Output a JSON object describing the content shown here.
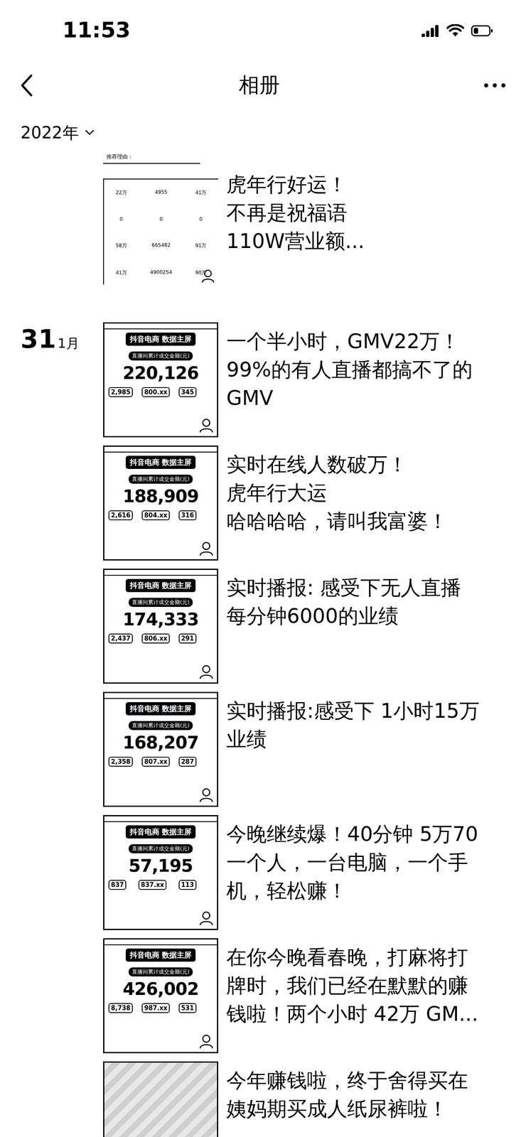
{
  "status_bar": {
    "time": "11:53",
    "signal_bars": 4,
    "battery": {
      "level": 0.35
    }
  },
  "nav": {
    "title": "相册"
  },
  "year_filter": {
    "label": "2022年"
  },
  "groups": [
    {
      "date": null,
      "posts": [
        {
          "kind": "table",
          "thumb": {
            "note": "推荐理由：",
            "rows": [
              [
                "22万",
                "4955",
                "41万"
              ],
              [
                "0",
                "0",
                "0"
              ],
              [
                "58万",
                "665482",
                "91万"
              ],
              [
                "41万",
                "4900254",
                "90万"
              ]
            ]
          },
          "caption": [
            "虎年行好运！",
            "不再是祝福语",
            "110W营业额..."
          ]
        }
      ]
    },
    {
      "date": {
        "day": "31",
        "month": "1月"
      },
      "posts": [
        {
          "kind": "dashboard",
          "thumb": {
            "header": "抖音电商 数据主屏",
            "label": "直播间累计成交金额(元)",
            "value": "220,126",
            "stats": [
              "2,985",
              "800.xx",
              "345"
            ]
          },
          "caption": [
            "一个半小时，GMV22万！",
            "99%的有人直播都搞不了的",
            "GMV"
          ]
        },
        {
          "kind": "dashboard",
          "thumb": {
            "header": "抖音电商 数据主屏",
            "label": "直播间累计成交金额(元)",
            "value": "188,909",
            "stats": [
              "2,616",
              "804.xx",
              "316"
            ]
          },
          "caption": [
            "实时在线人数破万！",
            "虎年行大运",
            "哈哈哈哈，请叫我富婆！"
          ]
        },
        {
          "kind": "dashboard",
          "thumb": {
            "header": "抖音电商 数据主屏",
            "label": "直播间累计成交金额(元)",
            "value": "174,333",
            "stats": [
              "2,437",
              "806.xx",
              "291"
            ]
          },
          "caption": [
            "实时播报: 感受下无人直播",
            "每分钟6000的业绩"
          ]
        },
        {
          "kind": "dashboard",
          "thumb": {
            "header": "抖音电商 数据主屏",
            "label": "直播间累计成交金额(元)",
            "value": "168,207",
            "stats": [
              "2,358",
              "807.xx",
              "287"
            ]
          },
          "caption": [
            "实时播报:感受下 1小时15万",
            "业绩"
          ]
        },
        {
          "kind": "dashboard",
          "thumb": {
            "header": "抖音电商 数据主屏",
            "label": "直播间累计成交金额(元)",
            "value": "57,195",
            "stats": [
              "837",
              "837.xx",
              "113"
            ]
          },
          "caption": [
            "今晚继续爆！40分钟 5万70",
            "一个人，一台电脑，一个手",
            "机，轻松赚！"
          ]
        },
        {
          "kind": "dashboard",
          "thumb": {
            "header": "抖音电商 数据主屏",
            "label": "直播间累计成交金额(元)",
            "value": "426,002",
            "stats": [
              "8,738",
              "987.xx",
              "531"
            ]
          },
          "caption": [
            "在你今晚看春晚，打麻将打",
            "牌时，我们已经在默默的赚",
            "钱啦！两个小时 42万 GM..."
          ]
        },
        {
          "kind": "photo",
          "thumb": {},
          "caption": [
            "今年赚钱啦，终于舍得买在",
            "姨妈期买成人纸尿裤啦！"
          ]
        }
      ]
    }
  ]
}
